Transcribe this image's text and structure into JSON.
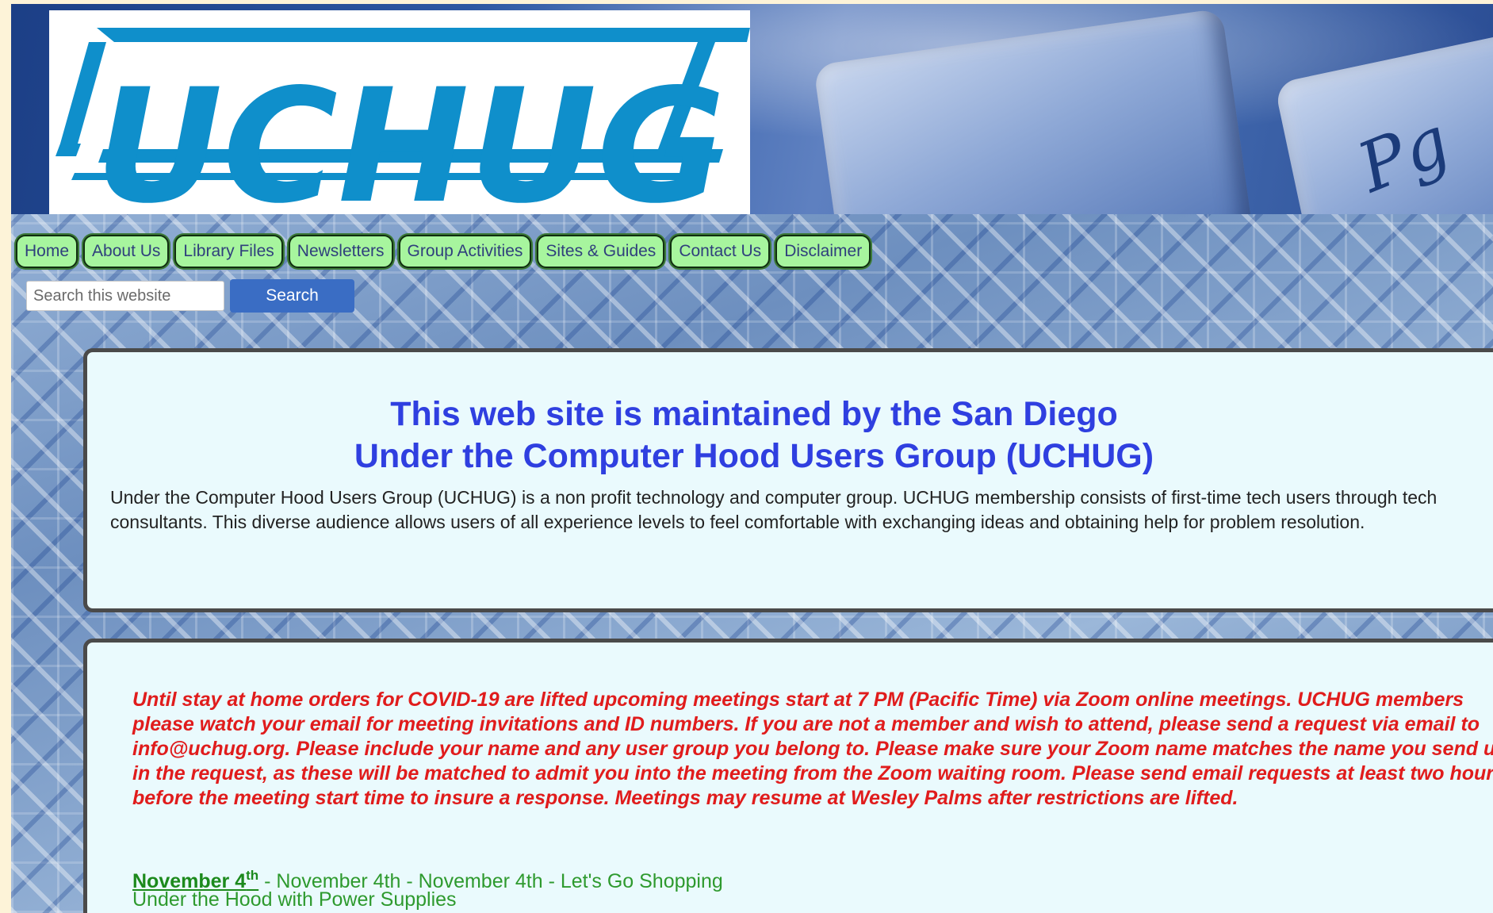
{
  "logo": {
    "text": "UCHUG"
  },
  "banner": {
    "key_label": "Pg"
  },
  "nav": {
    "items": [
      {
        "label": "Home"
      },
      {
        "label": "About Us"
      },
      {
        "label": "Library Files"
      },
      {
        "label": "Newsletters"
      },
      {
        "label": "Group Activities"
      },
      {
        "label": "Sites & Guides"
      },
      {
        "label": "Contact Us"
      },
      {
        "label": "Disclaimer"
      }
    ]
  },
  "search": {
    "placeholder": "Search this website",
    "value": "",
    "button_label": "Search"
  },
  "intro": {
    "heading_line1": "This web site is maintained by the San Diego",
    "heading_line2": "Under the Computer Hood Users Group (UCHUG)",
    "body": "Under the Computer Hood Users Group (UCHUG) is a non profit technology and computer group. UCHUG membership consists of first-time tech users through tech consultants. This diverse audience allows users of all experience levels to feel comfortable with exchanging ideas and obtaining help for problem resolution."
  },
  "events": {
    "notice": "Until stay at home orders for COVID-19 are lifted upcoming meetings start at 7 PM (Pacific Time) via Zoom online meetings. UCHUG members please watch your email for meeting invitations and ID numbers. If you are not a member and wish to attend, please send a request via email to info@uchug.org.  Please include your name and any user group you belong to.  Please make sure your Zoom name matches the name you send us in the request, as these will be matched to admit you into the meeting from the Zoom waiting room.  Please send email requests at least two hours before the meeting start time to insure a response.  Meetings may resume at Wesley Palms after restrictions are lifted.",
    "date_link": "November 4",
    "date_sup": "th",
    "date_rest": " - November 4th - November 4th - Let's Go Shopping",
    "title": "Under the Hood with Power Supplies"
  },
  "colors": {
    "heading": "#2f3fe0",
    "notice": "#e01c1c",
    "event_green": "#2e9a2e",
    "nav_button": "#a7f59e",
    "search_button": "#3a6dc4",
    "logo": "#0f8fcb",
    "panel": "#eafafd"
  }
}
